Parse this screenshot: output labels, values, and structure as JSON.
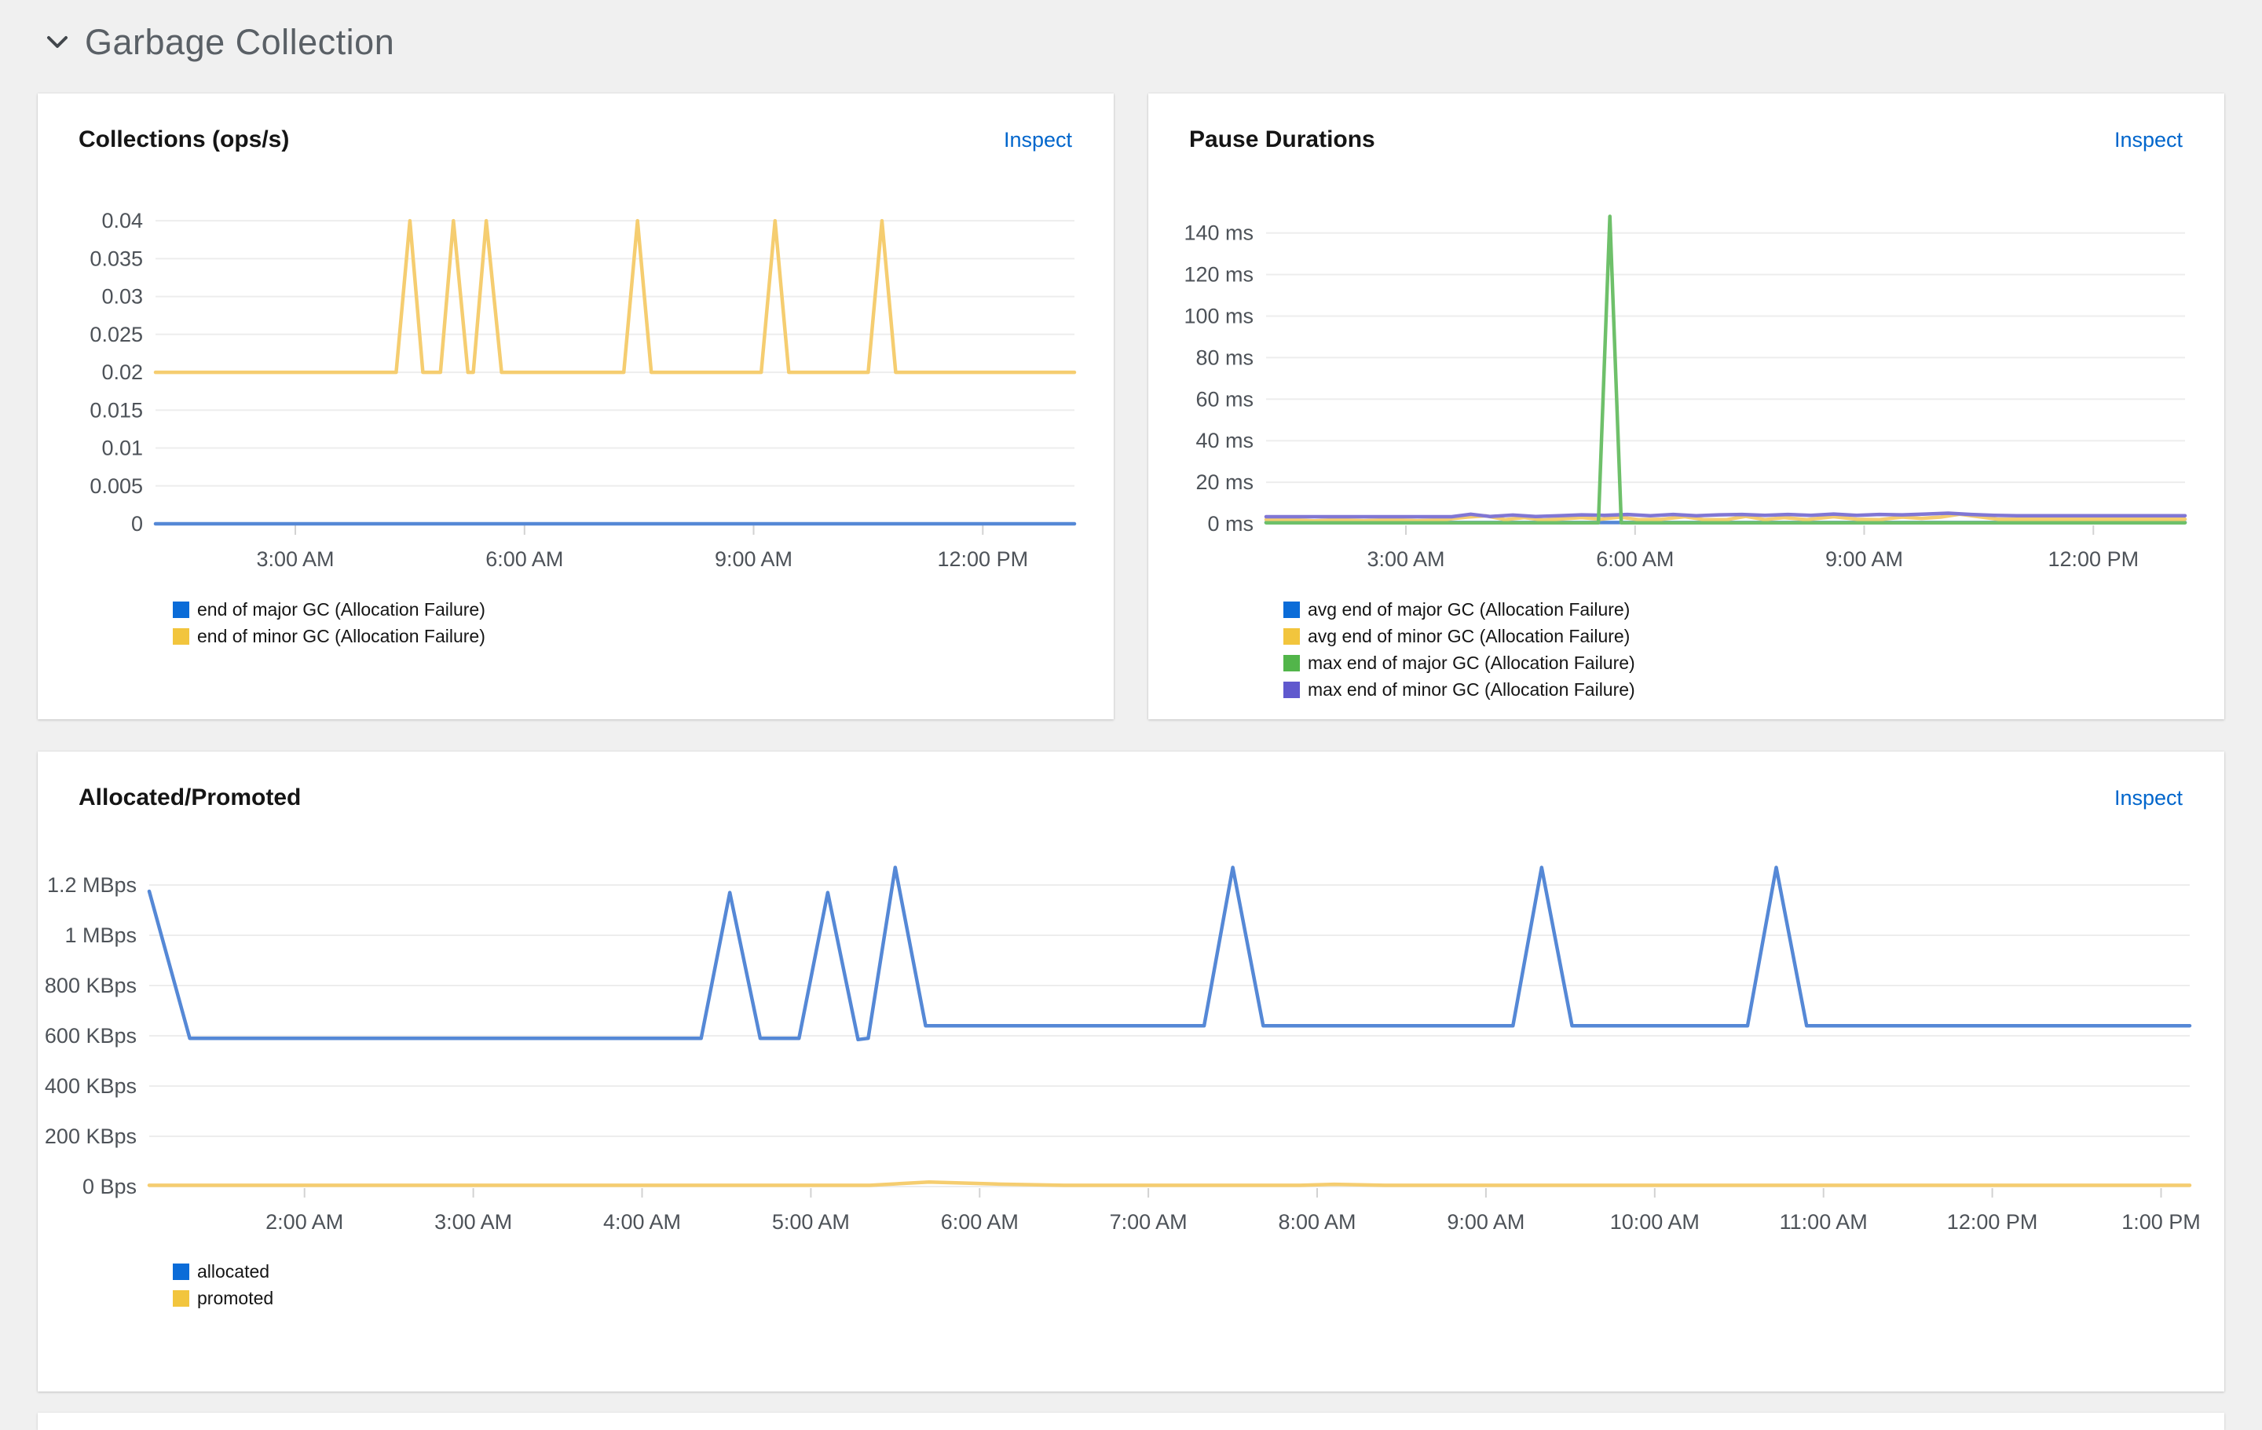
{
  "page": {
    "background": "#f0f0f0",
    "section": {
      "title": "Garbage Collection",
      "collapse_icon": "chevron-down-icon"
    }
  },
  "panels": [
    {
      "title": "Collections (ops/s)",
      "inspect_label": "Inspect",
      "legend": [
        {
          "label": "end of major GC (Allocation Failure)",
          "color": "#0b6cd8"
        },
        {
          "label": "end of minor GC (Allocation Failure)",
          "color": "#f2c53d"
        }
      ]
    },
    {
      "title": "Pause Durations",
      "inspect_label": "Inspect",
      "legend": [
        {
          "label": "avg end of major GC (Allocation Failure)",
          "color": "#0b6cd8"
        },
        {
          "label": "avg end of minor GC (Allocation Failure)",
          "color": "#f2c53d"
        },
        {
          "label": "max end of major GC (Allocation Failure)",
          "color": "#52b54a"
        },
        {
          "label": "max end of minor GC (Allocation Failure)",
          "color": "#6059ce"
        }
      ]
    },
    {
      "title": "Allocated/Promoted",
      "inspect_label": "Inspect",
      "legend": [
        {
          "label": "allocated",
          "color": "#0b6cd8"
        },
        {
          "label": "promoted",
          "color": "#f2c53d"
        }
      ]
    }
  ],
  "chart_data": [
    {
      "type": "line",
      "title": "Collections (ops/s)",
      "ylabel": "ops/s",
      "x_unit": "hour_of_day",
      "x_range": [
        1.17,
        13.2
      ],
      "x_ticks": [
        {
          "v": 3,
          "label": "3:00 AM"
        },
        {
          "v": 6,
          "label": "6:00 AM"
        },
        {
          "v": 9,
          "label": "9:00 AM"
        },
        {
          "v": 12,
          "label": "12:00 PM"
        }
      ],
      "y_ticks": [
        {
          "v": 0,
          "label": "0"
        },
        {
          "v": 0.005,
          "label": "0.005"
        },
        {
          "v": 0.01,
          "label": "0.01"
        },
        {
          "v": 0.015,
          "label": "0.015"
        },
        {
          "v": 0.02,
          "label": "0.02"
        },
        {
          "v": 0.025,
          "label": "0.025"
        },
        {
          "v": 0.03,
          "label": "0.03"
        },
        {
          "v": 0.035,
          "label": "0.035"
        },
        {
          "v": 0.04,
          "label": "0.04"
        }
      ],
      "y_plot_range": [
        0,
        0.0425
      ],
      "grid": "horizontal",
      "legend_position": "bottom-left",
      "series": [
        {
          "name": "end of major GC (Allocation Failure)",
          "color": "#5588d6",
          "points": [
            [
              1.17,
              0
            ],
            [
              13.2,
              0
            ]
          ]
        },
        {
          "name": "end of minor GC (Allocation Failure)",
          "color": "#f5cd70",
          "points": [
            [
              1.17,
              0.02
            ],
            [
              4.32,
              0.02
            ],
            [
              4.5,
              0.04
            ],
            [
              4.67,
              0.02
            ],
            [
              4.9,
              0.02
            ],
            [
              5.07,
              0.04
            ],
            [
              5.26,
              0.02
            ],
            [
              5.33,
              0.02
            ],
            [
              5.5,
              0.04
            ],
            [
              5.7,
              0.02
            ],
            [
              7.3,
              0.02
            ],
            [
              7.48,
              0.04
            ],
            [
              7.66,
              0.02
            ],
            [
              9.1,
              0.02
            ],
            [
              9.28,
              0.04
            ],
            [
              9.46,
              0.02
            ],
            [
              10.5,
              0.02
            ],
            [
              10.68,
              0.04
            ],
            [
              10.86,
              0.02
            ],
            [
              13.2,
              0.02
            ]
          ]
        }
      ]
    },
    {
      "type": "line",
      "title": "Pause Durations",
      "y_unit": "ms",
      "x_unit": "hour_of_day",
      "x_range": [
        1.17,
        13.2
      ],
      "x_ticks": [
        {
          "v": 3,
          "label": "3:00 AM"
        },
        {
          "v": 6,
          "label": "6:00 AM"
        },
        {
          "v": 9,
          "label": "9:00 AM"
        },
        {
          "v": 12,
          "label": "12:00 PM"
        }
      ],
      "y_ticks": [
        {
          "v": 0,
          "label": "0 ms"
        },
        {
          "v": 20,
          "label": "20 ms"
        },
        {
          "v": 40,
          "label": "40 ms"
        },
        {
          "v": 60,
          "label": "60 ms"
        },
        {
          "v": 80,
          "label": "80 ms"
        },
        {
          "v": 100,
          "label": "100 ms"
        },
        {
          "v": 120,
          "label": "120 ms"
        },
        {
          "v": 140,
          "label": "140 ms"
        }
      ],
      "y_plot_range": [
        0,
        155
      ],
      "grid": "horizontal",
      "legend_position": "bottom-left",
      "series": [
        {
          "name": "avg end of major GC (Allocation Failure)",
          "color": "#5588d6",
          "points": [
            [
              1.17,
              0.6
            ],
            [
              13.2,
              0.6
            ]
          ]
        },
        {
          "name": "avg end of minor GC (Allocation Failure)",
          "color": "#f5cd70",
          "points": [
            [
              1.17,
              2.0
            ],
            [
              1.5,
              2.0
            ],
            [
              1.8,
              1.4
            ],
            [
              2.1,
              2.0
            ],
            [
              2.45,
              1.5
            ],
            [
              2.8,
              2.0
            ],
            [
              3.15,
              1.5
            ],
            [
              3.5,
              2.0
            ],
            [
              3.8,
              3.2
            ],
            [
              4.05,
              3.8
            ],
            [
              4.3,
              2.0
            ],
            [
              4.55,
              3.0
            ],
            [
              4.8,
              1.8
            ],
            [
              5.05,
              2.4
            ],
            [
              5.3,
              3.0
            ],
            [
              5.55,
              2.2
            ],
            [
              5.8,
              3.2
            ],
            [
              6.05,
              2.0
            ],
            [
              6.35,
              2.2
            ],
            [
              6.65,
              3.4
            ],
            [
              6.9,
              2.0
            ],
            [
              7.2,
              2.0
            ],
            [
              7.45,
              3.6
            ],
            [
              7.7,
              2.0
            ],
            [
              7.95,
              3.0
            ],
            [
              8.25,
              2.0
            ],
            [
              8.6,
              3.4
            ],
            [
              8.9,
              2.2
            ],
            [
              9.2,
              2.0
            ],
            [
              9.5,
              3.2
            ],
            [
              9.75,
              2.6
            ],
            [
              10.0,
              3.2
            ],
            [
              10.25,
              4.6
            ],
            [
              10.5,
              3.4
            ],
            [
              10.75,
              2.2
            ],
            [
              11.05,
              2.2
            ],
            [
              13.2,
              2.2
            ]
          ]
        },
        {
          "name": "max end of minor GC (Allocation Failure)",
          "color": "#8177d4",
          "points": [
            [
              1.17,
              3.4
            ],
            [
              3.6,
              3.4
            ],
            [
              3.85,
              4.6
            ],
            [
              4.1,
              3.5
            ],
            [
              4.4,
              4.2
            ],
            [
              4.7,
              3.5
            ],
            [
              5.0,
              3.9
            ],
            [
              5.3,
              4.3
            ],
            [
              5.6,
              4.1
            ],
            [
              5.9,
              4.5
            ],
            [
              6.2,
              3.9
            ],
            [
              6.5,
              4.5
            ],
            [
              6.8,
              3.9
            ],
            [
              7.1,
              4.3
            ],
            [
              7.4,
              4.5
            ],
            [
              7.7,
              4.1
            ],
            [
              8.0,
              4.5
            ],
            [
              8.3,
              4.1
            ],
            [
              8.6,
              4.7
            ],
            [
              8.9,
              4.1
            ],
            [
              9.2,
              4.5
            ],
            [
              9.5,
              4.3
            ],
            [
              9.8,
              4.7
            ],
            [
              10.1,
              5.1
            ],
            [
              10.4,
              4.5
            ],
            [
              10.7,
              4.1
            ],
            [
              11.0,
              3.9
            ],
            [
              13.2,
              3.9
            ]
          ]
        },
        {
          "name": "max end of major GC (Allocation Failure)",
          "color": "#6ec06a",
          "points": [
            [
              1.17,
              0.5
            ],
            [
              5.52,
              0.5
            ],
            [
              5.67,
              148
            ],
            [
              5.82,
              0.5
            ],
            [
              13.2,
              0.5
            ]
          ]
        }
      ]
    },
    {
      "type": "line",
      "title": "Allocated/Promoted",
      "y_unit": "bytes_per_second",
      "x_unit": "hour_of_day",
      "x_range": [
        1.08,
        13.17
      ],
      "x_ticks": [
        {
          "v": 2,
          "label": "2:00 AM"
        },
        {
          "v": 3,
          "label": "3:00 AM"
        },
        {
          "v": 4,
          "label": "4:00 AM"
        },
        {
          "v": 5,
          "label": "5:00 AM"
        },
        {
          "v": 6,
          "label": "6:00 AM"
        },
        {
          "v": 7,
          "label": "7:00 AM"
        },
        {
          "v": 8,
          "label": "8:00 AM"
        },
        {
          "v": 9,
          "label": "9:00 AM"
        },
        {
          "v": 10,
          "label": "10:00 AM"
        },
        {
          "v": 11,
          "label": "11:00 AM"
        },
        {
          "v": 12,
          "label": "12:00 PM"
        },
        {
          "v": 13,
          "label": "1:00 PM"
        }
      ],
      "y_ticks": [
        {
          "v": 0,
          "label": "0 Bps"
        },
        {
          "v": 200000,
          "label": "200 KBps"
        },
        {
          "v": 400000,
          "label": "400 KBps"
        },
        {
          "v": 600000,
          "label": "600 KBps"
        },
        {
          "v": 800000,
          "label": "800 KBps"
        },
        {
          "v": 1000000,
          "label": "1 MBps"
        },
        {
          "v": 1200000,
          "label": "1.2 MBps"
        }
      ],
      "y_plot_range": [
        0,
        1300000
      ],
      "grid": "horizontal",
      "legend_position": "bottom-left",
      "series": [
        {
          "name": "promoted",
          "color": "#f5cd70",
          "points": [
            [
              1.08,
              5000
            ],
            [
              5.35,
              5000
            ],
            [
              5.7,
              18000
            ],
            [
              6.1,
              10000
            ],
            [
              6.5,
              5000
            ],
            [
              7.9,
              5000
            ],
            [
              8.1,
              9000
            ],
            [
              8.4,
              5000
            ],
            [
              13.17,
              5000
            ]
          ]
        },
        {
          "name": "allocated",
          "color": "#5588d6",
          "points": [
            [
              1.08,
              1175000
            ],
            [
              1.32,
              590000
            ],
            [
              4.35,
              590000
            ],
            [
              4.52,
              1170000
            ],
            [
              4.7,
              590000
            ],
            [
              4.93,
              590000
            ],
            [
              5.1,
              1170000
            ],
            [
              5.28,
              585000
            ],
            [
              5.34,
              590000
            ],
            [
              5.5,
              1270000
            ],
            [
              5.68,
              640000
            ],
            [
              7.33,
              640000
            ],
            [
              7.5,
              1270000
            ],
            [
              7.68,
              640000
            ],
            [
              9.16,
              640000
            ],
            [
              9.33,
              1270000
            ],
            [
              9.51,
              640000
            ],
            [
              10.55,
              640000
            ],
            [
              10.72,
              1270000
            ],
            [
              10.9,
              640000
            ],
            [
              13.17,
              640000
            ]
          ]
        }
      ]
    }
  ]
}
